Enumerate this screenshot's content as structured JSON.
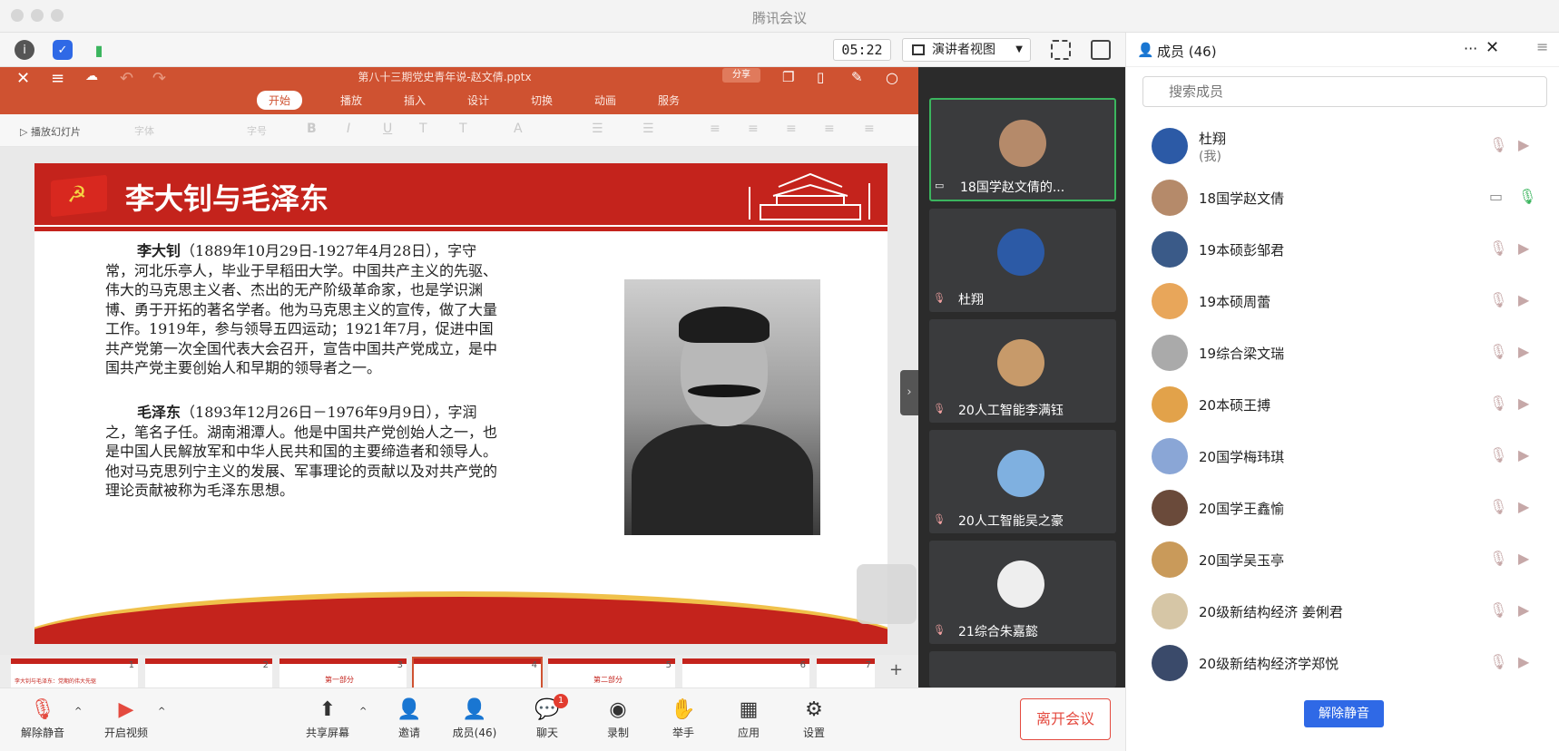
{
  "app": {
    "title": "腾讯会议"
  },
  "toolbar": {
    "timer": "05:22",
    "view_label": "演讲者视图"
  },
  "ppt": {
    "filename": "第八十三期党史青年说-赵文倩.pptx",
    "share_label": "分享",
    "tabs": [
      "开始",
      "播放",
      "插入",
      "设计",
      "切换",
      "动画",
      "服务"
    ],
    "ribbon": {
      "play_label": "播放幻灯片",
      "font_placeholder": "字体",
      "size_placeholder": "字号"
    }
  },
  "slide": {
    "title": "李大钊与毛泽东",
    "para1_name": "李大钊",
    "para1_text": "（1889年10月29日-1927年4月28日），字守常，河北乐亭人，毕业于早稻田大学。中国共产主义的先驱、伟大的马克思主义者、杰出的无产阶级革命家，也是学识渊博、勇于开拓的著名学者。他为马克思主义的宣传，做了大量工作。1919年，参与领导五四运动；1921年7月，促进中国共产党第一次全国代表大会召开，宣告中国共产党成立，是中国共产党主要创始人和早期的领导者之一。",
    "para2_name": "毛泽东",
    "para2_text": "（1893年12月26日－1976年9月9日），字润之，笔名子任。湖南湘潭人。他是中国共产党创始人之一，也是中国人民解放军和中华人民共和国的主要缔造者和领导人。他对马克思列宁主义的发展、军事理论的贡献以及对共产党的理论贡献被称为毛泽东思想。"
  },
  "thumbnails": [
    {
      "num": "1",
      "caption": "李大钊与毛泽东：党期的伟大先驱"
    },
    {
      "num": "2",
      "caption": ""
    },
    {
      "num": "3",
      "caption": "第一部分"
    },
    {
      "num": "4",
      "caption": ""
    },
    {
      "num": "5",
      "caption": "第二部分"
    },
    {
      "num": "6",
      "caption": ""
    },
    {
      "num": "7",
      "caption": ""
    }
  ],
  "video_tiles": [
    {
      "name": "18国学赵文倩的...",
      "avatar_color": "#b58a6a"
    },
    {
      "name": "杜翔",
      "avatar_color": "#2c5aa6"
    },
    {
      "name": "20人工智能李满钰",
      "avatar_color": "#c79a6a"
    },
    {
      "name": "20人工智能吴之豪",
      "avatar_color": "#7fb0e0"
    },
    {
      "name": "21综合朱嘉懿",
      "avatar_color": "#eeeeee"
    }
  ],
  "bottom": {
    "mute": "解除静音",
    "video": "开启视频",
    "share": "共享屏幕",
    "invite": "邀请",
    "members": "成员(46)",
    "chat": "聊天",
    "chat_badge": "1",
    "record": "录制",
    "raise": "举手",
    "apps": "应用",
    "settings": "设置",
    "leave": "离开会议"
  },
  "panel": {
    "title": "成员 (46)",
    "search_placeholder": "搜索成员",
    "unmute_button": "解除静音",
    "members": [
      {
        "name": "杜翔",
        "sub": "(我)",
        "color": "#2c5aa6"
      },
      {
        "name": "18国学赵文倩",
        "sub": "",
        "color": "#b58a6a"
      },
      {
        "name": "19本硕彭邹君",
        "sub": "",
        "color": "#3a5a88"
      },
      {
        "name": "19本硕周蕾",
        "sub": "",
        "color": "#e8a65a"
      },
      {
        "name": "19综合梁文瑞",
        "sub": "",
        "color": "#aaaaaa"
      },
      {
        "name": "20本硕王搏",
        "sub": "",
        "color": "#e2a24a"
      },
      {
        "name": "20国学梅玮琪",
        "sub": "",
        "color": "#8aa6d6"
      },
      {
        "name": "20国学王鑫愉",
        "sub": "",
        "color": "#6a4a3a"
      },
      {
        "name": "20国学吴玉亭",
        "sub": "",
        "color": "#c99a5a"
      },
      {
        "name": "20级新结构经济 姜俐君",
        "sub": "",
        "color": "#d6c6a6"
      },
      {
        "name": "20级新结构经济学郑悦",
        "sub": "",
        "color": "#3a4a6a"
      }
    ]
  }
}
